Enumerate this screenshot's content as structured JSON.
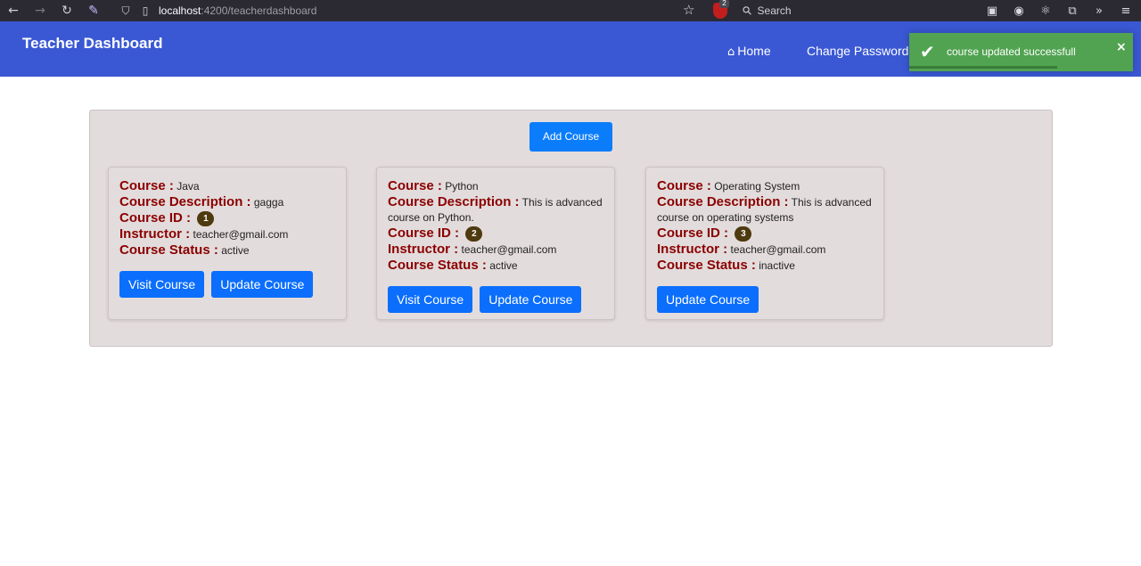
{
  "browser": {
    "url_host": "localhost",
    "url_path": ":4200/teacherdashboard",
    "search_placeholder": "Search",
    "ublock_count": "2"
  },
  "navbar": {
    "brand": "Teacher Dashboard",
    "home_label": "Home",
    "change_password_label": "Change Password"
  },
  "toast": {
    "message": "course updated successfull",
    "close": "×",
    "progress": 0.66
  },
  "actions": {
    "add_course": "Add Course"
  },
  "labels": {
    "course": "Course :",
    "description": "Course Description :",
    "id": "Course ID :",
    "instructor": "Instructor :",
    "status": "Course Status :"
  },
  "courses": [
    {
      "name": "Java",
      "description": "gagga",
      "id": "1",
      "instructor": "teacher@gmail.com",
      "status": "active",
      "visit_label": "Visit Course",
      "update_label": "Update Course"
    },
    {
      "name": "Python",
      "description": "This is advanced course on Python.",
      "id": "2",
      "instructor": "teacher@gmail.com",
      "status": "active",
      "visit_label": "Visit Course",
      "update_label": "Update Course"
    },
    {
      "name": "Operating System",
      "description": "This is advanced course on operating systems",
      "id": "3",
      "instructor": "teacher@gmail.com",
      "status": "inactive",
      "update_label": "Update Course"
    }
  ],
  "colors": {
    "navbar": "#3a58d4",
    "toast": "#51a351",
    "label": "#8b0000",
    "button": "#0b6efd",
    "panel": "#e3dcdc"
  }
}
